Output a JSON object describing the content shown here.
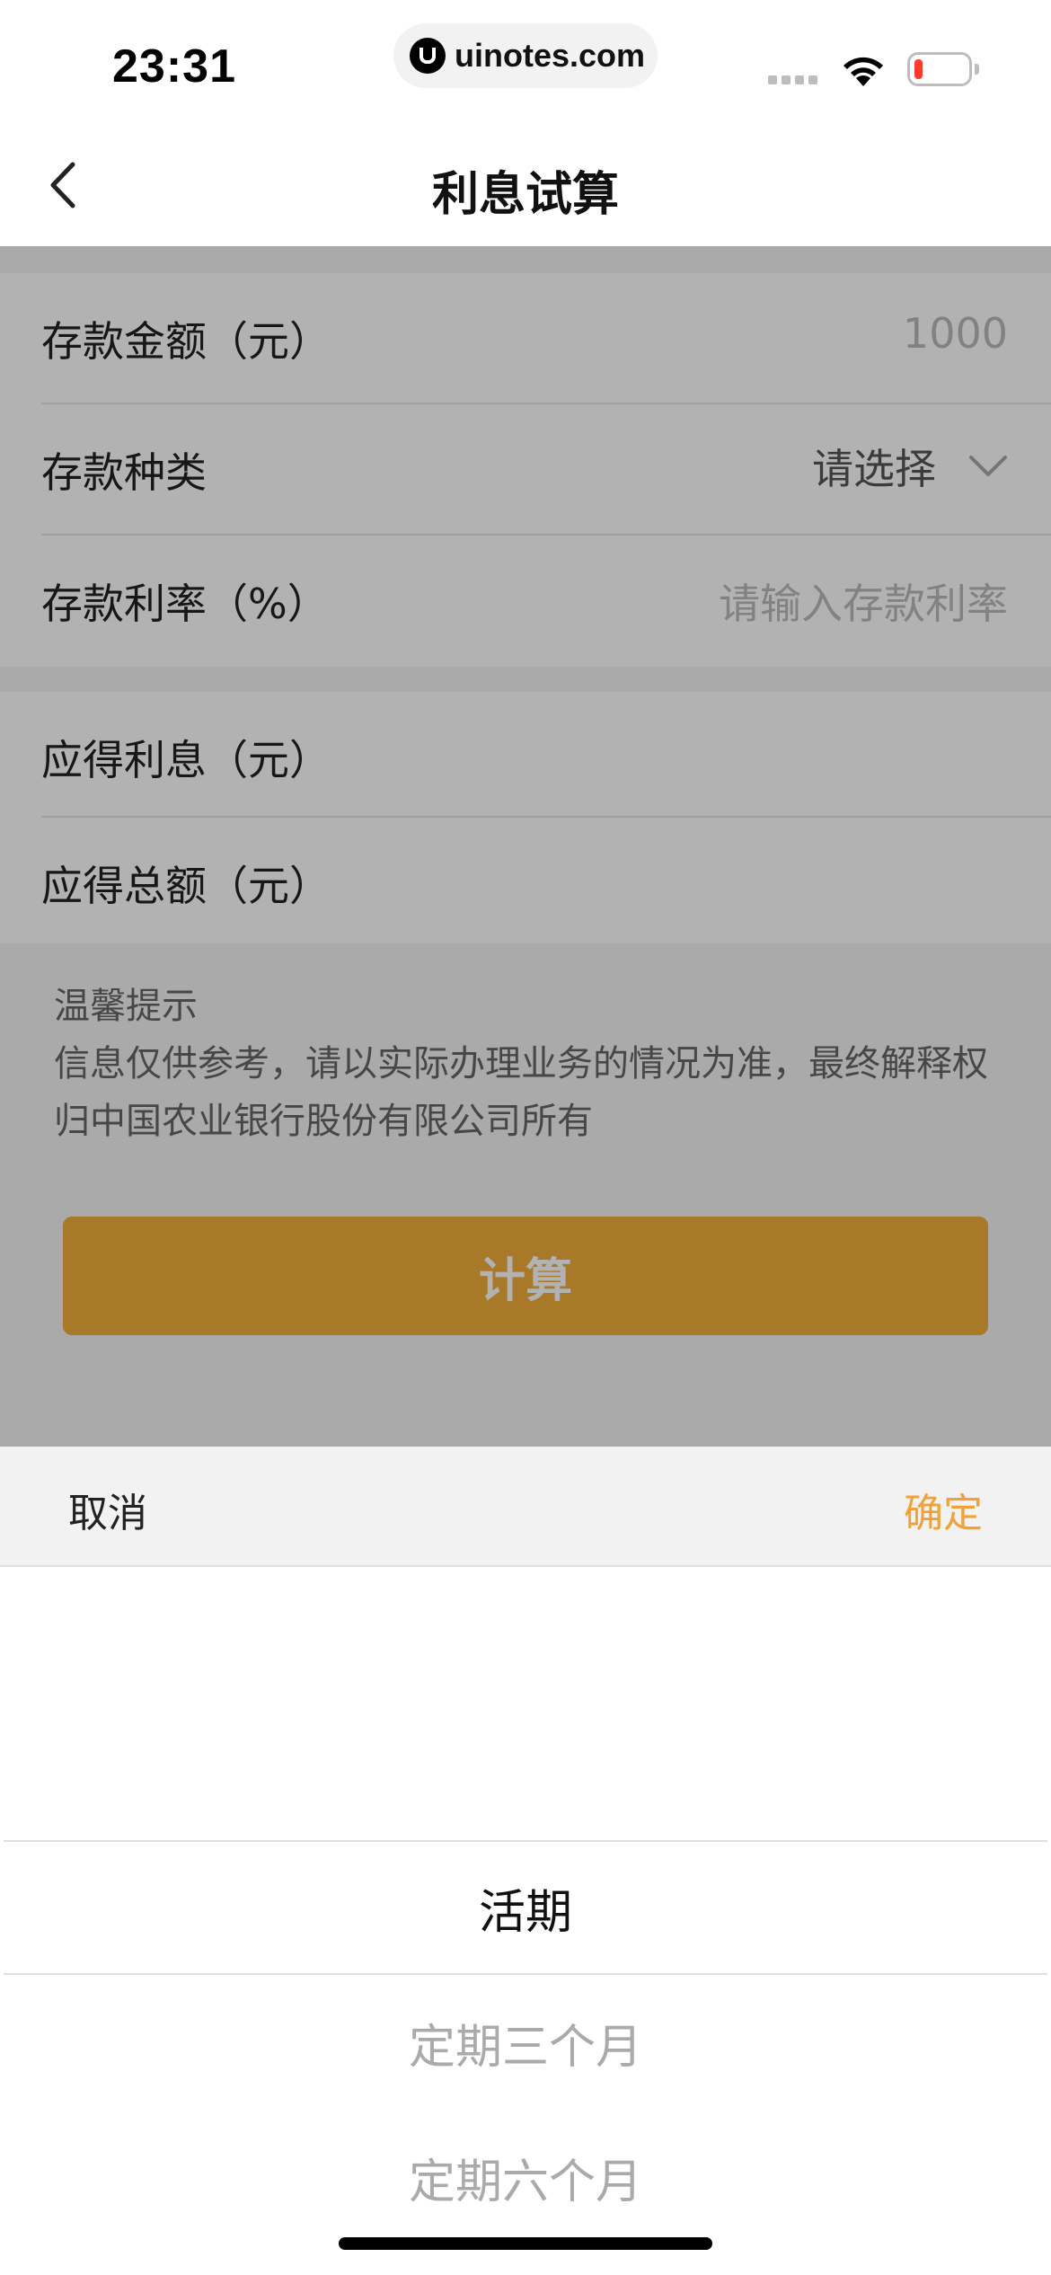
{
  "status_bar": {
    "time": "23:31",
    "url": "uinotes.com",
    "battery_level": 0.15,
    "battery_color": "#ff3b30"
  },
  "nav": {
    "title": "利息试算",
    "back_icon": "chevron-left-icon"
  },
  "form": {
    "amount": {
      "label": "存款金额（元）",
      "value": "1000"
    },
    "type": {
      "label": "存款种类",
      "value": "请选择",
      "icon": "chevron-down-icon"
    },
    "rate": {
      "label": "存款利率（%）",
      "placeholder": "请输入存款利率"
    },
    "interest": {
      "label": "应得利息（元）"
    },
    "total": {
      "label": "应得总额（元）"
    }
  },
  "tip": {
    "title": "温馨提示",
    "body": "信息仅供参考，请以实际办理业务的情况为准，最终解释权归中国农业银行股份有限公司所有"
  },
  "calc_button": {
    "label": "计算",
    "color": "#f1ae3b"
  },
  "picker": {
    "cancel_label": "取消",
    "confirm_label": "确定",
    "confirm_color": "#f0a23a",
    "options": [
      "活期",
      "定期三个月",
      "定期六个月"
    ],
    "selected_index": 0
  }
}
